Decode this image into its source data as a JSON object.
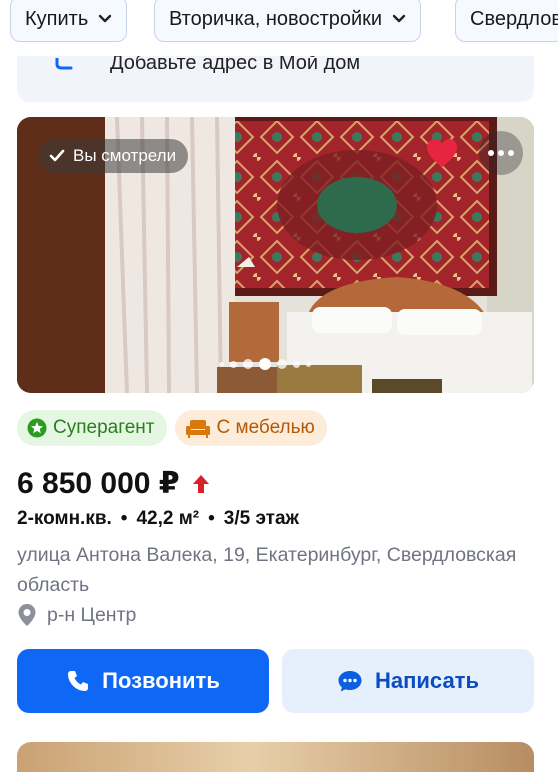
{
  "filters": [
    {
      "label": "Купить",
      "has_chevron": true
    },
    {
      "label": "Вторичка, новостройки",
      "has_chevron": true
    },
    {
      "label": "Свердловская"
    }
  ],
  "banner": {
    "text": "Добавьте адрес в Мой дом",
    "icon": "house-icon"
  },
  "listing": {
    "viewed_label": "Вы смотрели",
    "favorite": true,
    "photo_dots": 7,
    "active_dot": 3,
    "badges": [
      {
        "label": "Суперагент",
        "icon": "star-badge-icon",
        "color": "#2a7d1e"
      },
      {
        "label": "С мебелью",
        "icon": "sofa-icon",
        "color": "#b35a09"
      }
    ],
    "price": "6 850 000 ₽",
    "price_trend": "up",
    "params": [
      "2-комн.кв.",
      "42,2 м²",
      "3/5 этаж"
    ],
    "param_separator": "•",
    "address": "улица Антона Валека, 19, Екатеринбург, Свердловская область",
    "district": "р-н Центр",
    "call_label": "Позвонить",
    "write_label": "Написать"
  },
  "colors": {
    "primary": "#0f68f5",
    "favorite": "#e8253f",
    "price_up": "#d81f2a"
  }
}
